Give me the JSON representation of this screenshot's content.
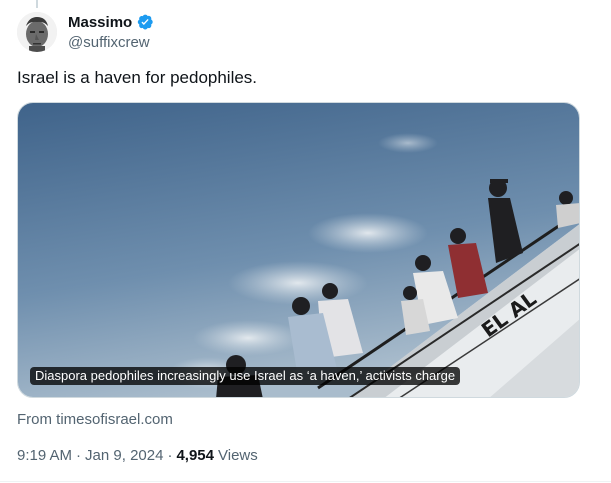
{
  "author": {
    "display_name": "Massimo",
    "handle": "@suffixcrew",
    "verified": true,
    "verified_color": "#1d9bf0"
  },
  "tweet": {
    "text": "Israel is a haven for pedophiles."
  },
  "card": {
    "caption": "Diaspora pedophiles increasingly use Israel as ‘a haven,’ activists charge",
    "airline_text": "EL AL",
    "source": "From timesofisrael.com"
  },
  "meta": {
    "time": "9:19 AM",
    "separator": "·",
    "date": "Jan 9, 2024",
    "separator2": "·",
    "views_count": "4,954",
    "views_label": "Views"
  },
  "colors": {
    "text_primary": "#0f1419",
    "text_secondary": "#536471",
    "sky_top": "#46698f",
    "sky_bottom": "#b9c9d6"
  },
  "icons": {
    "verified": "verified-badge-icon",
    "avatar": "statue-avatar"
  }
}
